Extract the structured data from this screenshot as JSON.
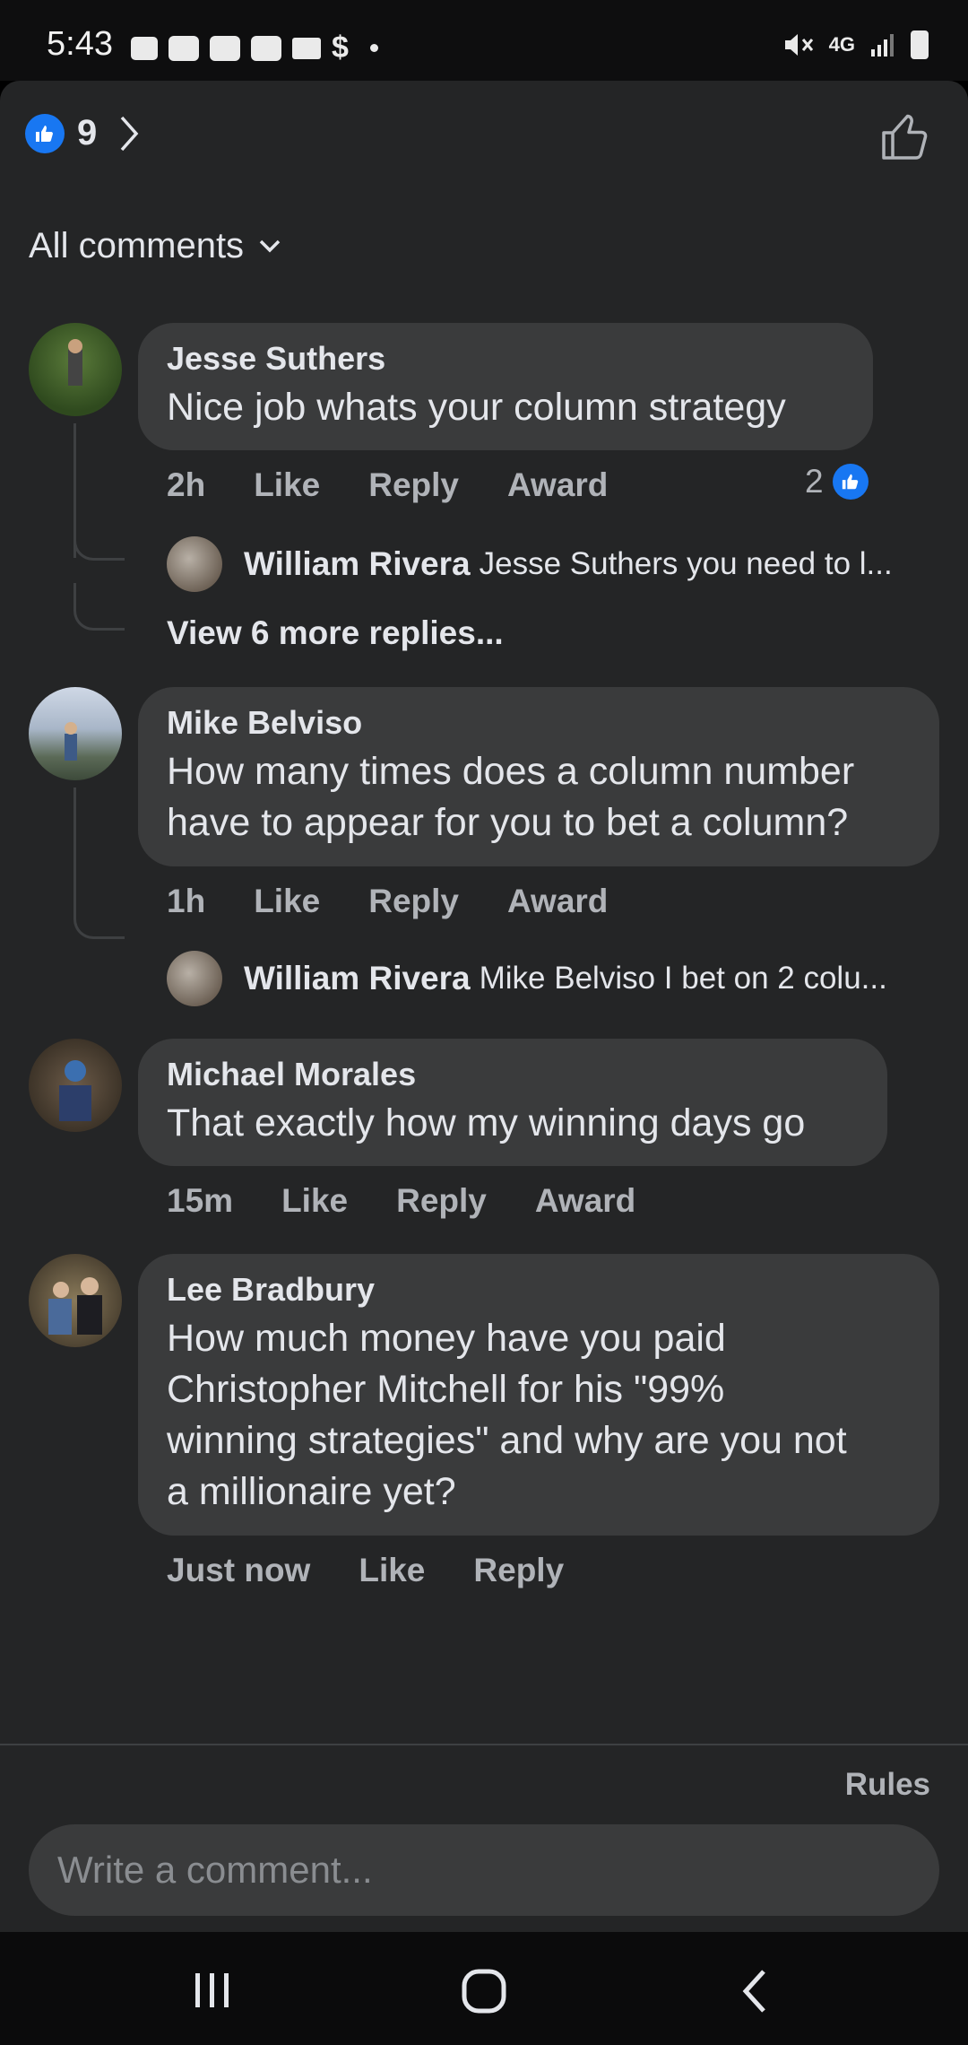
{
  "status_bar": {
    "time": "5:43",
    "network": "4G"
  },
  "header": {
    "reaction_count": "9"
  },
  "filter": {
    "label": "All comments"
  },
  "comments": [
    {
      "author": "Jesse Suthers",
      "text": "Nice job whats your column strategy",
      "time": "2h",
      "like": "Like",
      "reply": "Reply",
      "award": "Award",
      "like_count": "2",
      "replies": [
        {
          "author": "William Rivera",
          "text": "Jesse Suthers you need to l..."
        }
      ],
      "view_more": "View 6 more replies..."
    },
    {
      "author": "Mike Belviso",
      "text_lines": [
        "How many times does a column number",
        "have to appear for you to bet a column?"
      ],
      "time": "1h",
      "like": "Like",
      "reply": "Reply",
      "award": "Award",
      "replies": [
        {
          "author": "William Rivera",
          "text": "Mike Belviso I bet on 2 colu..."
        }
      ]
    },
    {
      "author": "Michael Morales",
      "text": "That exactly how my winning days go",
      "time": "15m",
      "like": "Like",
      "reply": "Reply",
      "award": "Award"
    },
    {
      "author": "Lee Bradbury",
      "text_lines": [
        "How much money have you paid",
        "Christopher Mitchell for his \"99%",
        "winning strategies\" and why are you not",
        "a millionaire yet?"
      ],
      "time": "Just now",
      "like": "Like",
      "reply": "Reply"
    }
  ],
  "footer": {
    "rules": "Rules",
    "composer_placeholder": "Write a comment..."
  },
  "colors": {
    "background": "#242526",
    "bubble": "#3a3b3c",
    "accent": "#1877f2",
    "secondary_text": "#b0b3b8"
  }
}
